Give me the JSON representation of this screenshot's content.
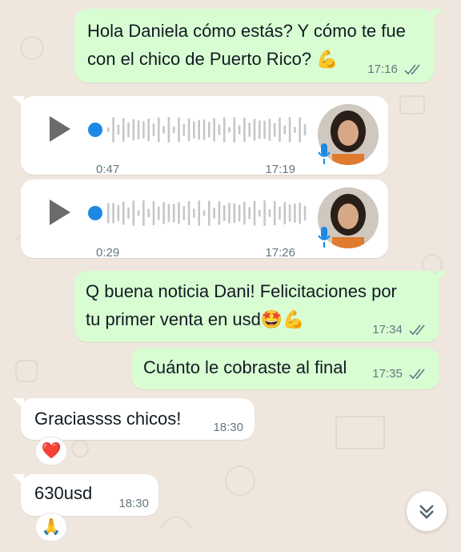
{
  "messages": [
    {
      "id": "m1",
      "direction": "outgoing",
      "line1": "Hola Daniela cómo estás? Y cómo te fue",
      "line2": "con el chico de Puerto Rico?",
      "emoji": "💪",
      "time": "17:16"
    },
    {
      "id": "m2",
      "direction": "incoming",
      "type": "voice",
      "duration": "0:47",
      "time": "17:19"
    },
    {
      "id": "m3",
      "direction": "incoming",
      "type": "voice",
      "duration": "0:29",
      "time": "17:26"
    },
    {
      "id": "m4",
      "direction": "outgoing",
      "line1": "Q buena noticia Dani! Felicitaciones por",
      "line2": "tu primer venta en usd",
      "emoji": "🤩💪",
      "time": "17:34"
    },
    {
      "id": "m5",
      "direction": "outgoing",
      "text": "Cuánto le cobraste al final",
      "time": "17:35"
    },
    {
      "id": "m6",
      "direction": "incoming",
      "text": "Graciassss chicos!",
      "time": "18:30",
      "reaction": "❤️"
    },
    {
      "id": "m7",
      "direction": "incoming",
      "text": "630usd",
      "time": "18:30",
      "reaction": "🙏"
    }
  ],
  "icons": {
    "read_receipt": "double-check-icon",
    "play": "play-icon",
    "mic": "microphone-icon",
    "scroll": "chevron-double-down-icon"
  },
  "colors": {
    "outgoing_bubble": "#d9fdd3",
    "incoming_bubble": "#ffffff",
    "background": "#efe7dd",
    "accent_blue": "#1e88e5",
    "tick": "#667781"
  }
}
